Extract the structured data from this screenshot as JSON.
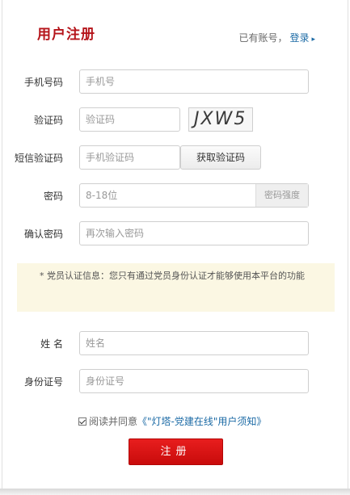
{
  "header": {
    "title": "用户注册",
    "has_account_text": "已有账号，",
    "login_link": "登录",
    "login_arrow": "▸"
  },
  "form": {
    "phone": {
      "label": "手机号码",
      "placeholder": "手机号"
    },
    "captcha": {
      "label": "验证码",
      "placeholder": "验证码",
      "image_text": "JXW5"
    },
    "sms": {
      "label": "短信验证码",
      "placeholder": "手机验证码",
      "button": "获取验证码"
    },
    "password": {
      "label": "密码",
      "placeholder": "8-18位",
      "strength": "密码强度"
    },
    "confirm_password": {
      "label": "确认密码",
      "placeholder": "再次输入密码"
    },
    "notice": "* 党员认证信息：您只有通过党员身份认证才能够使用本平台的功能",
    "name": {
      "label": "姓 名",
      "placeholder": "姓名"
    },
    "id_number": {
      "label": "身份证号",
      "placeholder": "身份证号"
    },
    "agreement": {
      "checked": true,
      "prefix": "阅读并同意",
      "terms": "《\"灯塔-党建在线\"用户须知》"
    },
    "submit": "注册"
  },
  "colors": {
    "title": "#b5141a",
    "link": "#1b6aa5",
    "submit": "#d71414",
    "notice_bg": "#fbf7e3"
  }
}
